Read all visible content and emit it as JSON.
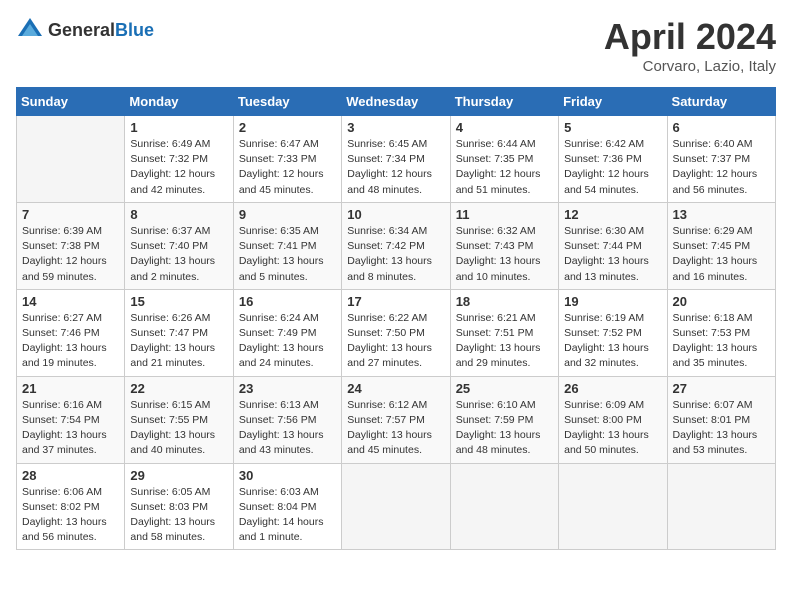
{
  "header": {
    "logo": {
      "general": "General",
      "blue": "Blue"
    },
    "title": "April 2024",
    "subtitle": "Corvaro, Lazio, Italy"
  },
  "calendar": {
    "days_of_week": [
      "Sunday",
      "Monday",
      "Tuesday",
      "Wednesday",
      "Thursday",
      "Friday",
      "Saturday"
    ],
    "weeks": [
      [
        {
          "day": "",
          "info": ""
        },
        {
          "day": "1",
          "info": "Sunrise: 6:49 AM\nSunset: 7:32 PM\nDaylight: 12 hours\nand 42 minutes."
        },
        {
          "day": "2",
          "info": "Sunrise: 6:47 AM\nSunset: 7:33 PM\nDaylight: 12 hours\nand 45 minutes."
        },
        {
          "day": "3",
          "info": "Sunrise: 6:45 AM\nSunset: 7:34 PM\nDaylight: 12 hours\nand 48 minutes."
        },
        {
          "day": "4",
          "info": "Sunrise: 6:44 AM\nSunset: 7:35 PM\nDaylight: 12 hours\nand 51 minutes."
        },
        {
          "day": "5",
          "info": "Sunrise: 6:42 AM\nSunset: 7:36 PM\nDaylight: 12 hours\nand 54 minutes."
        },
        {
          "day": "6",
          "info": "Sunrise: 6:40 AM\nSunset: 7:37 PM\nDaylight: 12 hours\nand 56 minutes."
        }
      ],
      [
        {
          "day": "7",
          "info": "Sunrise: 6:39 AM\nSunset: 7:38 PM\nDaylight: 12 hours\nand 59 minutes."
        },
        {
          "day": "8",
          "info": "Sunrise: 6:37 AM\nSunset: 7:40 PM\nDaylight: 13 hours\nand 2 minutes."
        },
        {
          "day": "9",
          "info": "Sunrise: 6:35 AM\nSunset: 7:41 PM\nDaylight: 13 hours\nand 5 minutes."
        },
        {
          "day": "10",
          "info": "Sunrise: 6:34 AM\nSunset: 7:42 PM\nDaylight: 13 hours\nand 8 minutes."
        },
        {
          "day": "11",
          "info": "Sunrise: 6:32 AM\nSunset: 7:43 PM\nDaylight: 13 hours\nand 10 minutes."
        },
        {
          "day": "12",
          "info": "Sunrise: 6:30 AM\nSunset: 7:44 PM\nDaylight: 13 hours\nand 13 minutes."
        },
        {
          "day": "13",
          "info": "Sunrise: 6:29 AM\nSunset: 7:45 PM\nDaylight: 13 hours\nand 16 minutes."
        }
      ],
      [
        {
          "day": "14",
          "info": "Sunrise: 6:27 AM\nSunset: 7:46 PM\nDaylight: 13 hours\nand 19 minutes."
        },
        {
          "day": "15",
          "info": "Sunrise: 6:26 AM\nSunset: 7:47 PM\nDaylight: 13 hours\nand 21 minutes."
        },
        {
          "day": "16",
          "info": "Sunrise: 6:24 AM\nSunset: 7:49 PM\nDaylight: 13 hours\nand 24 minutes."
        },
        {
          "day": "17",
          "info": "Sunrise: 6:22 AM\nSunset: 7:50 PM\nDaylight: 13 hours\nand 27 minutes."
        },
        {
          "day": "18",
          "info": "Sunrise: 6:21 AM\nSunset: 7:51 PM\nDaylight: 13 hours\nand 29 minutes."
        },
        {
          "day": "19",
          "info": "Sunrise: 6:19 AM\nSunset: 7:52 PM\nDaylight: 13 hours\nand 32 minutes."
        },
        {
          "day": "20",
          "info": "Sunrise: 6:18 AM\nSunset: 7:53 PM\nDaylight: 13 hours\nand 35 minutes."
        }
      ],
      [
        {
          "day": "21",
          "info": "Sunrise: 6:16 AM\nSunset: 7:54 PM\nDaylight: 13 hours\nand 37 minutes."
        },
        {
          "day": "22",
          "info": "Sunrise: 6:15 AM\nSunset: 7:55 PM\nDaylight: 13 hours\nand 40 minutes."
        },
        {
          "day": "23",
          "info": "Sunrise: 6:13 AM\nSunset: 7:56 PM\nDaylight: 13 hours\nand 43 minutes."
        },
        {
          "day": "24",
          "info": "Sunrise: 6:12 AM\nSunset: 7:57 PM\nDaylight: 13 hours\nand 45 minutes."
        },
        {
          "day": "25",
          "info": "Sunrise: 6:10 AM\nSunset: 7:59 PM\nDaylight: 13 hours\nand 48 minutes."
        },
        {
          "day": "26",
          "info": "Sunrise: 6:09 AM\nSunset: 8:00 PM\nDaylight: 13 hours\nand 50 minutes."
        },
        {
          "day": "27",
          "info": "Sunrise: 6:07 AM\nSunset: 8:01 PM\nDaylight: 13 hours\nand 53 minutes."
        }
      ],
      [
        {
          "day": "28",
          "info": "Sunrise: 6:06 AM\nSunset: 8:02 PM\nDaylight: 13 hours\nand 56 minutes."
        },
        {
          "day": "29",
          "info": "Sunrise: 6:05 AM\nSunset: 8:03 PM\nDaylight: 13 hours\nand 58 minutes."
        },
        {
          "day": "30",
          "info": "Sunrise: 6:03 AM\nSunset: 8:04 PM\nDaylight: 14 hours\nand 1 minute."
        },
        {
          "day": "",
          "info": ""
        },
        {
          "day": "",
          "info": ""
        },
        {
          "day": "",
          "info": ""
        },
        {
          "day": "",
          "info": ""
        }
      ]
    ]
  }
}
